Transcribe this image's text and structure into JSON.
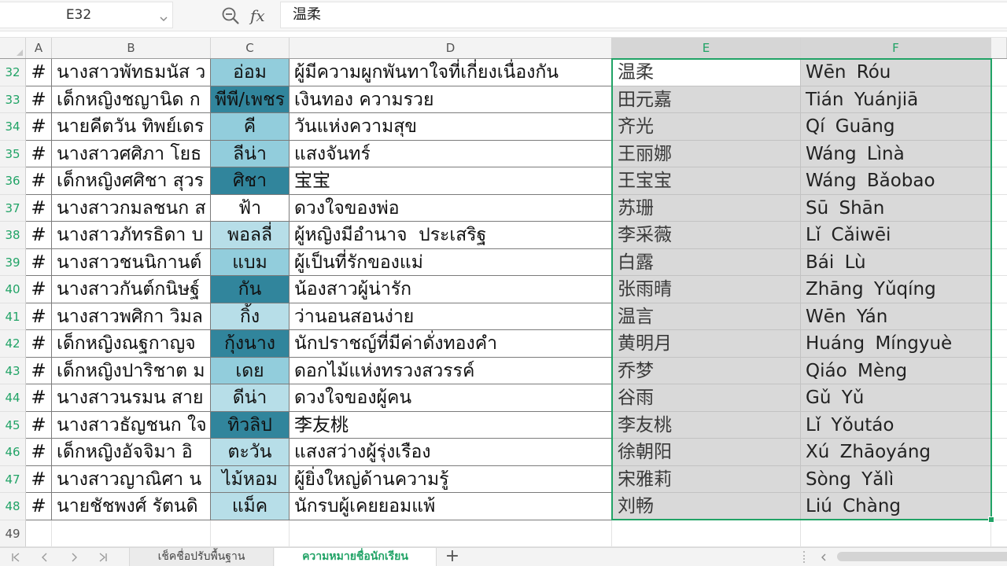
{
  "formula_bar": {
    "name_box": "E32",
    "fx_label": "fx",
    "formula": "温柔"
  },
  "column_headers": [
    "A",
    "B",
    "C",
    "D",
    "E",
    "F"
  ],
  "rows": [
    {
      "num": "32",
      "a": "#",
      "b": "นางสาวพัทธมนัส ว",
      "c": "อ่อม",
      "c_fill": "#92cddc",
      "d": "ผู้มีความผูกพันทาใจที่เกี่ยงเนื่องกัน",
      "e": "温柔",
      "f": "Wēn Róu"
    },
    {
      "num": "33",
      "a": "#",
      "b": "เด็กหญิงชญานิด ก",
      "c": "พีพี/เพชร",
      "c_fill": "#31859c",
      "d": "เงินทอง ความรวย",
      "e": "田元嘉",
      "f": "Tián Yuánjiā"
    },
    {
      "num": "34",
      "a": "#",
      "b": "นายคีตวัน ทิพย์เดร",
      "c": "คี",
      "c_fill": "#92cddc",
      "d": "วันแห่งความสุข",
      "e": "齐光",
      "f": "Qí Guāng"
    },
    {
      "num": "35",
      "a": "#",
      "b": "นางสาวศศิภา โยธ",
      "c": "ลีน่า",
      "c_fill": "#92cddc",
      "d": "แสงจันทร์",
      "e": "王丽娜",
      "f": "Wáng Lìnà"
    },
    {
      "num": "36",
      "a": "#",
      "b": "เด็กหญิงศศิชา สุวร",
      "c": "ศิชา",
      "c_fill": "#31859c",
      "d": "宝宝",
      "e": "王宝宝",
      "f": "Wáng Bǎobao"
    },
    {
      "num": "37",
      "a": "#",
      "b": "นางสาวกมลชนก ส",
      "c": "ฟ้า",
      "c_fill": "#ffffff",
      "d": "ดวงใจของพ่อ",
      "e": "苏珊",
      "f": "Sū Shān"
    },
    {
      "num": "38",
      "a": "#",
      "b": "นางสาวภัทรธิดา บ",
      "c": "พอลลี่",
      "c_fill": "#b7dee8",
      "d": "ผู้หญิงมีอำนาจ  ประเสริฐ",
      "e": "李采薇",
      "f": "Lǐ Cǎiwēi"
    },
    {
      "num": "39",
      "a": "#",
      "b": "นางสาวชนนิกานต์",
      "c": "แบม",
      "c_fill": "#92cddc",
      "d": "ผู้เป็นที่รักของแม่",
      "e": "白露",
      "f": "Bái Lù"
    },
    {
      "num": "40",
      "a": "#",
      "b": "นางสาวกันต์กนิษฐ์",
      "c": "กัน",
      "c_fill": "#31859c",
      "d": "น้องสาวผู้น่ารัก",
      "e": "张雨晴",
      "f": "Zhāng Yǔqíng"
    },
    {
      "num": "41",
      "a": "#",
      "b": "นางสาวพศิกา วิมล",
      "c": "กิ้ง",
      "c_fill": "#b7dee8",
      "d": "ว่านอนสอนง่าย",
      "e": "温言",
      "f": "Wēn Yán"
    },
    {
      "num": "42",
      "a": "#",
      "b": "เด็กหญิงณฐกาญจ",
      "c": "กุ้งนาง",
      "c_fill": "#31859c",
      "d": "นักปราชญ์ที่มีค่าดั่งทองคำ",
      "e": "黄明月",
      "f": "Huáng Míngyuè"
    },
    {
      "num": "43",
      "a": "#",
      "b": "เด็กหญิงปาริชาต ม",
      "c": "เดย",
      "c_fill": "#92cddc",
      "d": "ดอกไม้แห่งทรวงสวรรค์",
      "e": "乔梦",
      "f": "Qiáo Mèng"
    },
    {
      "num": "44",
      "a": "#",
      "b": "นางสาวนรมน สาย",
      "c": "ดีน่า",
      "c_fill": "#b7dee8",
      "d": "ดวงใจของผู้คน",
      "e": "谷雨",
      "f": "Gǔ Yǔ"
    },
    {
      "num": "45",
      "a": "#",
      "b": "นางสาวธัญชนก ใจ",
      "c": "ทิวลิป",
      "c_fill": "#31859c",
      "d": "李友桃",
      "e": "李友桃",
      "f": "Lǐ Yǒutáo"
    },
    {
      "num": "46",
      "a": "#",
      "b": "เด็กหญิงอัจจิมา อิ",
      "c": "ตะวัน",
      "c_fill": "#b7dee8",
      "d": "แสงสว่างผู้รุ่งเรือง",
      "e": "徐朝阳",
      "f": "Xú Zhāoyáng"
    },
    {
      "num": "47",
      "a": "#",
      "b": "นางสาวญาณิศา น",
      "c": "ไม้หอม",
      "c_fill": "#b7dee8",
      "d": "ผู้ยิ่งใหญ่ด้านความรู้",
      "e": "宋雅莉",
      "f": "Sòng Yǎlì"
    },
    {
      "num": "48",
      "a": "#",
      "b": "นายชัชพงศ์ รัตนดิ",
      "c": "แม็ค",
      "c_fill": "#b7dee8",
      "d": "นักรบผู้เคยยอมแพ้",
      "e": "刘畅",
      "f": "Liú Chàng"
    }
  ],
  "empty_row": "49",
  "sheet_tabs": [
    {
      "label": "เช็คชื่อปรับพื้นฐาน",
      "active": false
    },
    {
      "label": "ความหมายชื่อนักเรียน",
      "active": true
    }
  ],
  "add_sheet_label": "+",
  "theme": {
    "accent": "#21a366",
    "selection_fill": "#d9d9d9"
  },
  "icons": {
    "name_box_dropdown": "chevron-down-icon",
    "formula_search": "zoom-out-icon",
    "first_sheet": "first-sheet-icon",
    "prev_sheet": "prev-sheet-icon",
    "next_sheet": "next-sheet-icon",
    "last_sheet": "last-sheet-icon",
    "scroll_left": "scroll-left-icon"
  }
}
